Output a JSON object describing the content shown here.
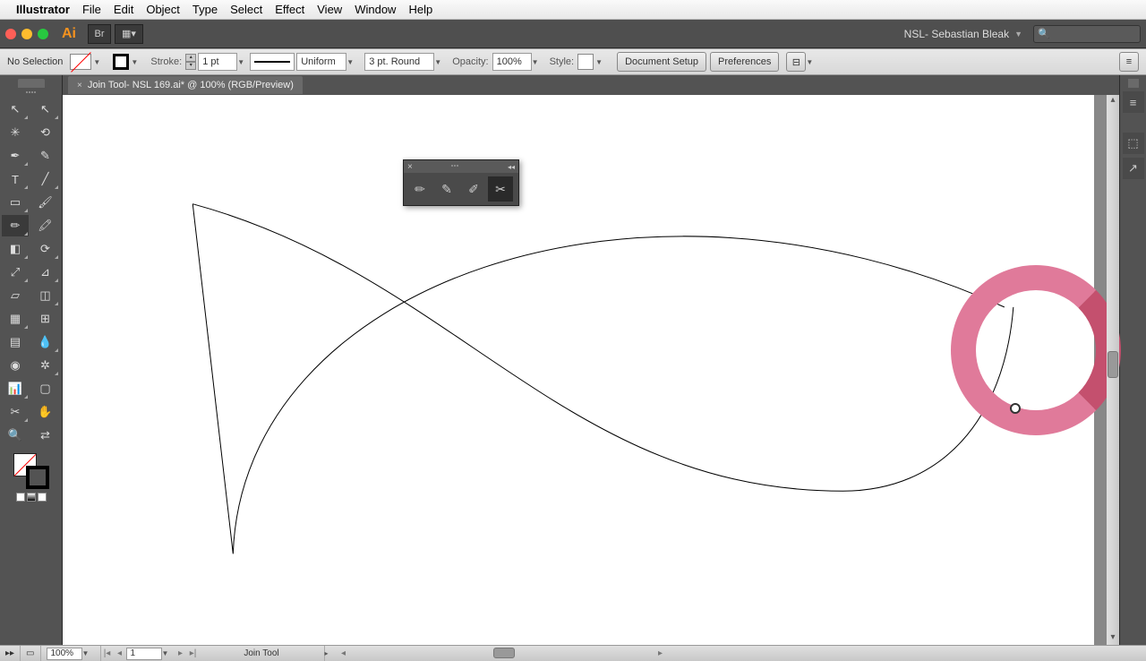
{
  "menubar": {
    "app": "Illustrator",
    "items": [
      "File",
      "Edit",
      "Object",
      "Type",
      "Select",
      "Effect",
      "View",
      "Window",
      "Help"
    ]
  },
  "toolbar": {
    "user_label": "NSL- Sebastian Bleak"
  },
  "control": {
    "selection_state": "No Selection",
    "stroke_label": "Stroke:",
    "stroke_value": "1 pt",
    "stroke_style": "Uniform",
    "brush_value": "3 pt. Round",
    "opacity_label": "Opacity:",
    "opacity_value": "100%",
    "style_label": "Style:",
    "doc_setup": "Document Setup",
    "preferences": "Preferences"
  },
  "document": {
    "tab_title": "Join Tool- NSL 169.ai* @ 100% (RGB/Preview)"
  },
  "status": {
    "zoom": "100%",
    "artboard": "1",
    "tool": "Join Tool"
  },
  "colors": {
    "accent_orange": "#f7931e",
    "pink_ring_light": "#e07a9a",
    "pink_ring_dark": "#c4506e",
    "panel_bg": "#535353"
  }
}
